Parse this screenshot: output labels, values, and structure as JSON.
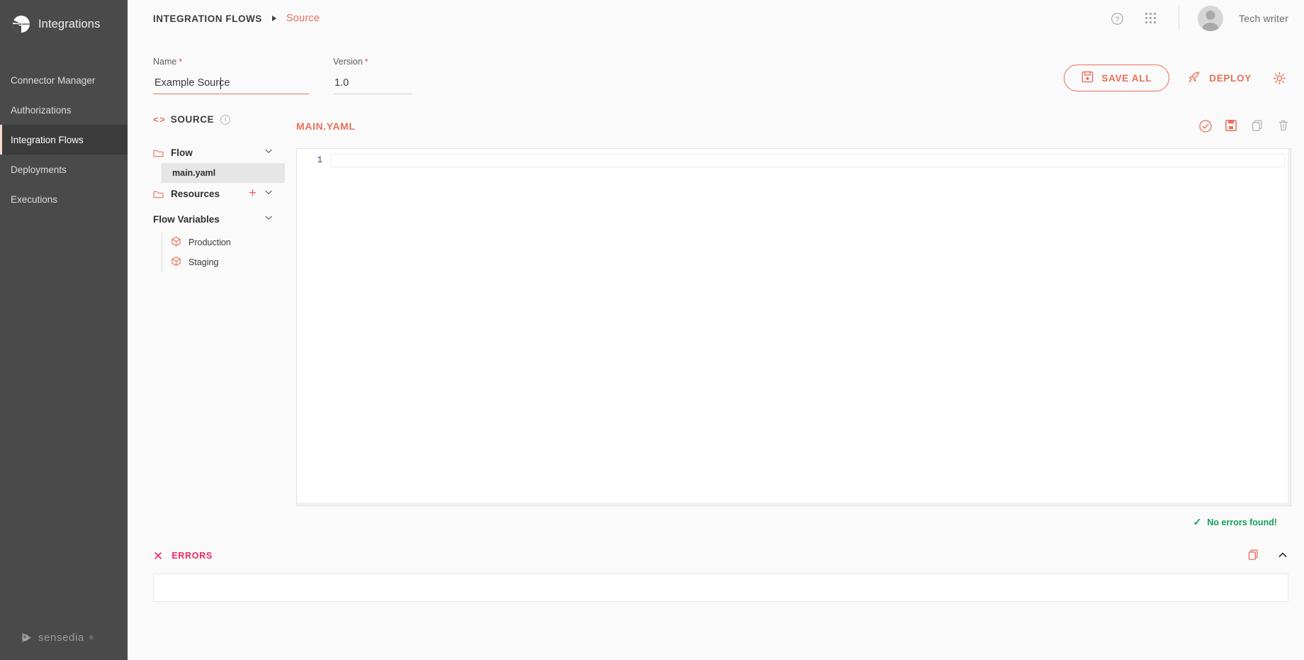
{
  "sidebar": {
    "brand": "Integrations",
    "brand_logo_icon": "integrations-fan-logo",
    "items": [
      {
        "label": "Connector Manager",
        "active": false
      },
      {
        "label": "Authorizations",
        "active": false
      },
      {
        "label": "Integration Flows",
        "active": true
      },
      {
        "label": "Deployments",
        "active": false
      },
      {
        "label": "Executions",
        "active": false
      }
    ],
    "footer": {
      "word": "sensedia",
      "reg": "®",
      "logo_icon": "sensedia-logo"
    }
  },
  "topbar": {
    "breadcrumb_root": "INTEGRATION FLOWS",
    "breadcrumb_arrow_icon": "caret-right-icon",
    "breadcrumb_leaf": "Source",
    "help_icon": "help-circle-icon",
    "apps_icon": "grid-apps-icon",
    "avatar_icon": "user-avatar",
    "username": "Tech writer"
  },
  "form": {
    "name_label": "Name",
    "name_value": "Example Source",
    "name_required": "*",
    "version_label": "Version",
    "version_value": "1.0",
    "version_required": "*"
  },
  "actions": {
    "save_all_label": "SAVE ALL",
    "save_all_icon": "save-floppy-icon",
    "deploy_label": "DEPLOY",
    "deploy_icon": "rocket-icon",
    "settings_icon": "gear-icon"
  },
  "tree": {
    "header_label": "SOURCE",
    "header_icon": "code-brackets-icon",
    "header_info_icon": "info-circle-icon",
    "info_glyph": "i",
    "flow": {
      "label": "Flow",
      "folder_icon": "folder-icon",
      "chevron_icon": "chevron-down-icon",
      "files": [
        {
          "name": "main.yaml",
          "selected": true
        }
      ]
    },
    "resources": {
      "label": "Resources",
      "folder_icon": "folder-icon",
      "add_icon": "plus-icon",
      "add_glyph": "+",
      "chevron_icon": "chevron-down-icon"
    },
    "flow_variables": {
      "label": "Flow Variables",
      "chevron_icon": "chevron-down-icon",
      "items": [
        {
          "label": "Production",
          "icon": "cube-icon"
        },
        {
          "label": "Staging",
          "icon": "cube-icon"
        }
      ]
    }
  },
  "editor": {
    "title": "MAIN.YAML",
    "tools": [
      {
        "name": "validate-icon",
        "icon": "check-circle-icon"
      },
      {
        "name": "save-icon",
        "icon": "save-floppy-icon"
      },
      {
        "name": "copy-icon",
        "icon": "copy-icon"
      },
      {
        "name": "delete-icon",
        "icon": "trash-icon"
      }
    ],
    "lines": [
      {
        "number": "1",
        "content": ""
      }
    ],
    "status_text": "No errors found!",
    "status_icon": "check-icon",
    "status_color": "#11a05a"
  },
  "errors_panel": {
    "label": "ERRORS",
    "close_icon": "x-icon",
    "copy_icon": "copy-icon",
    "collapse_icon": "chevron-up-icon",
    "collapse_glyph": "⌃"
  },
  "colors": {
    "accent": "#e8705a",
    "sidebar_bg": "#4a4a4a",
    "sidebar_active_bg": "#3b3b3b",
    "page_bg": "#fafafa",
    "error_pink": "#f0285f",
    "success_green": "#11a05a"
  }
}
